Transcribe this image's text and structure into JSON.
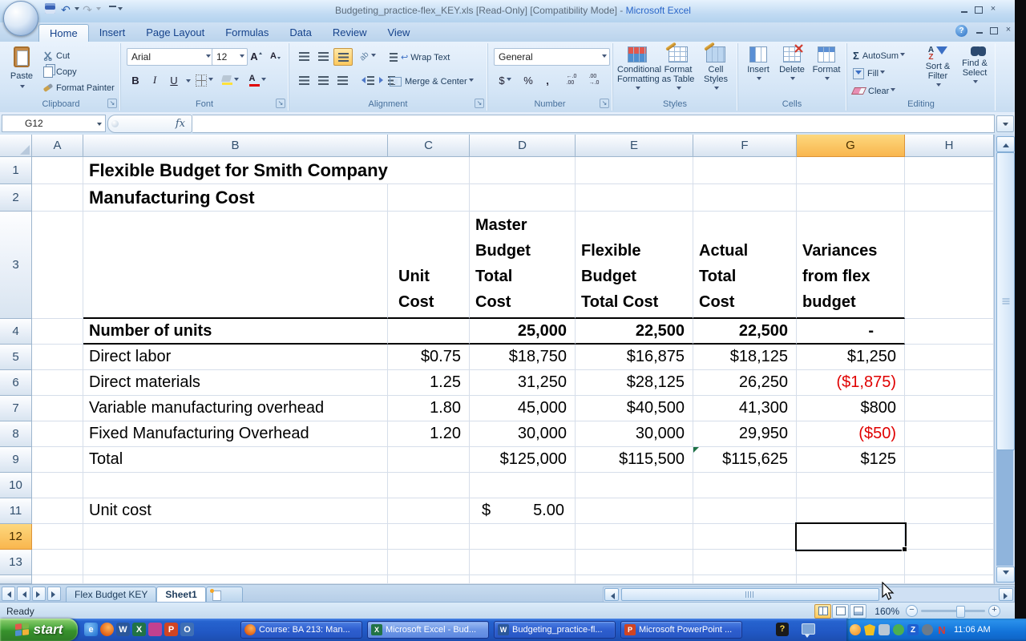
{
  "titlebar": {
    "doc_title": "Budgeting_practice-flex_KEY.xls  [Read-Only]  [Compatibility Mode] -",
    "app_title": "Microsoft Excel"
  },
  "glyphs": {
    "help": "?",
    "close": "×",
    "undo": "↶",
    "redo": "↷",
    "sigma": "Σ",
    "grow_font": "A",
    "shrink_font": "A",
    "sort_a": "A",
    "sort_z": "Z",
    "ie": "e",
    "word": "W",
    "excel": "X",
    "powerpoint": "P",
    "outlook": "O",
    "tray_n": "N",
    "tray_z": "Z",
    "fx": "fx",
    "wrap_arrow": "↩"
  },
  "ribbon_tabs": [
    "Home",
    "Insert",
    "Page Layout",
    "Formulas",
    "Data",
    "Review",
    "View"
  ],
  "ribbon": {
    "clipboard": {
      "label": "Clipboard",
      "paste": "Paste",
      "cut": "Cut",
      "copy": "Copy",
      "format_painter": "Format Painter"
    },
    "font": {
      "label": "Font",
      "name": "Arial",
      "size": "12",
      "bold": "B",
      "italic": "I",
      "underline": "U"
    },
    "alignment": {
      "label": "Alignment",
      "wrap_text": "Wrap Text",
      "merge_center": "Merge & Center"
    },
    "number": {
      "label": "Number",
      "format": "General",
      "currency": "$",
      "percent": "%",
      "comma": ",",
      "inc_decimal": "←.0\n.00",
      "dec_decimal": ".00\n→.0"
    },
    "styles": {
      "label": "Styles",
      "conditional": "Conditional Formatting",
      "as_table": "Format as Table",
      "cell_styles": "Cell Styles"
    },
    "cells": {
      "label": "Cells",
      "insert": "Insert",
      "delete": "Delete",
      "format": "Format"
    },
    "editing": {
      "label": "Editing",
      "autosum": "AutoSum",
      "fill": "Fill",
      "clear": "Clear",
      "sort_filter": "Sort & Filter",
      "find_select": "Find & Select"
    }
  },
  "formula_bar": {
    "name_box": "G12"
  },
  "grid": {
    "cols": [
      "A",
      "B",
      "C",
      "D",
      "E",
      "F",
      "G",
      "H"
    ],
    "rows": [
      "1",
      "2",
      "3",
      "4",
      "5",
      "6",
      "7",
      "8",
      "9",
      "10",
      "11",
      "12",
      "13"
    ],
    "selected_cell": "G12"
  },
  "sheet": {
    "title_line1": "Flexible Budget for Smith Company",
    "title_line2": "Manufacturing Cost",
    "col_headers": {
      "c": "Unit\nCost",
      "d": "Master\nBudget\nTotal\nCost",
      "e": "Flexible\nBudget\nTotal Cost",
      "f": "Actual\nTotal\nCost",
      "g": "Variances\nfrom flex\nbudget"
    },
    "data_rows": [
      {
        "b": "Number of units",
        "d": "25,000",
        "e": "22,500",
        "f": "22,500",
        "g": "-"
      },
      {
        "b": "Direct labor",
        "c": "$0.75",
        "d": "$18,750",
        "e": "$16,875",
        "f": "$18,125",
        "g": "$1,250"
      },
      {
        "b": "Direct materials",
        "c": "1.25",
        "d": "31,250",
        "e": "$28,125",
        "f": "26,250",
        "g": "($1,875)"
      },
      {
        "b": "Variable manufacturing overhead",
        "c": "1.80",
        "d": "45,000",
        "e": "$40,500",
        "f": "41,300",
        "g": "$800"
      },
      {
        "b": "Fixed Manufacturing Overhead",
        "c": "1.20",
        "d": "30,000",
        "e": "30,000",
        "f": "29,950",
        "g": "($50)"
      },
      {
        "b": "Total",
        "d": "$125,000",
        "e": "$115,500",
        "f": "$115,625",
        "g": "$125"
      }
    ],
    "unit_cost": {
      "label": "Unit cost",
      "symbol": "$",
      "value": "5.00"
    }
  },
  "sheet_tabs": {
    "tab1": "Flex Budget KEY",
    "tab2": "Sheet1"
  },
  "status_bar": {
    "mode": "Ready",
    "zoom_level": "160%"
  },
  "taskbar": {
    "start_label": "start",
    "task1": "Course: BA 213: Man...",
    "task2": "Microsoft Excel - Bud...",
    "task3": "Budgeting_practice-fl...",
    "task4": "Microsoft PowerPoint ...",
    "clock": "11:06 AM"
  },
  "colors": {
    "selection_header": "#F9B64E",
    "negative_value": "#E00000",
    "taskbar_blue": "#2663CF",
    "start_green": "#3F9934",
    "excel_green": "#217346"
  }
}
